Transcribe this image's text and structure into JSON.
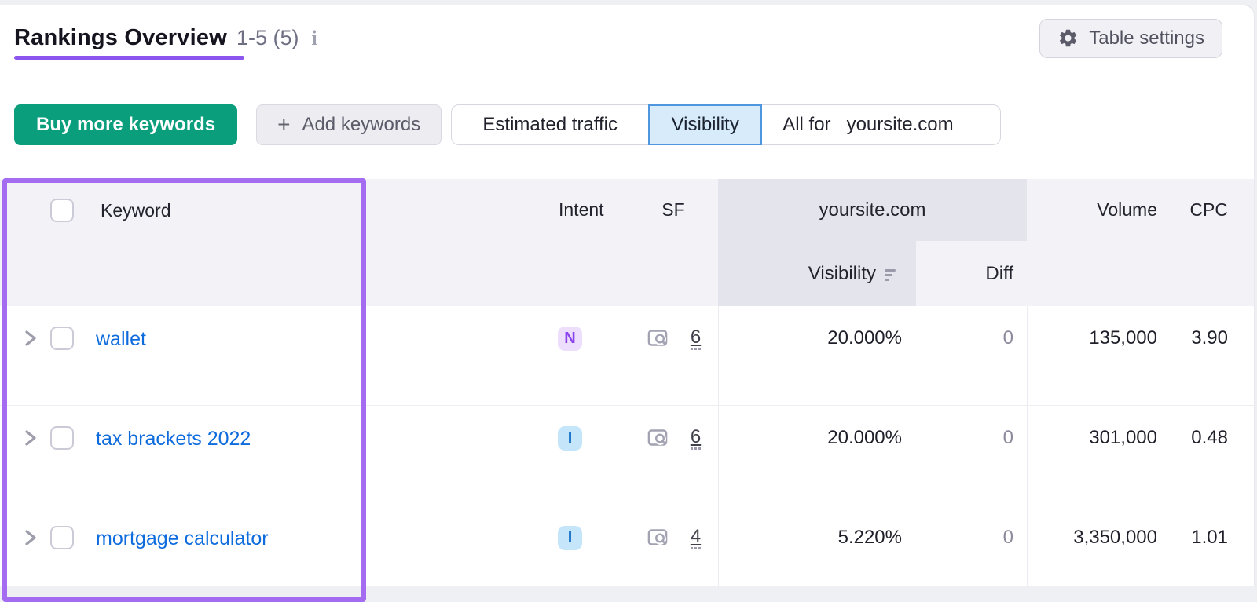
{
  "page": {
    "title": "Rankings Overview",
    "results_range": "1-5 (5)"
  },
  "icons": {
    "plus": "+",
    "info": "i"
  },
  "toolbar": {
    "table_settings": "Table settings",
    "buy_more": "Buy more keywords",
    "add_keywords": "Add keywords",
    "toggle": {
      "estimated_traffic": "Estimated traffic",
      "visibility": "Visibility",
      "selected": "Visibility",
      "all_for": "All for",
      "domain": "yoursite.com"
    }
  },
  "table": {
    "headers": {
      "keyword": "Keyword",
      "intent": "Intent",
      "sf": "SF",
      "domain_group": "yoursite.com",
      "visibility": "Visibility",
      "diff": "Diff",
      "volume": "Volume",
      "cpc": "CPC"
    },
    "rows": [
      {
        "keyword": "wallet",
        "intent": "N",
        "sf": "6",
        "visibility": "20.000%",
        "diff": "0",
        "volume": "135,000",
        "cpc": "3.90"
      },
      {
        "keyword": "tax brackets 2022",
        "intent": "I",
        "sf": "6",
        "visibility": "20.000%",
        "diff": "0",
        "volume": "301,000",
        "cpc": "0.48"
      },
      {
        "keyword": "mortgage calculator",
        "intent": "I",
        "sf": "4",
        "visibility": "5.220%",
        "diff": "0",
        "volume": "3,350,000",
        "cpc": "1.01"
      }
    ]
  },
  "colors": {
    "accent-purple": "#8d55ef",
    "annotation-purple": "#a46cf0",
    "green-button": "#0a9e7d",
    "link-blue": "#0d6bdd",
    "selected-toggle-bg": "#d7ebfb",
    "selected-toggle-border": "#4e96dd",
    "header-bg": "#f3f3f7",
    "group-header-bg": "#e4e4ec",
    "intent-n-bg": "#ecdefc",
    "intent-n-text": "#8a43ec",
    "intent-i-bg": "#c5e6fa",
    "intent-i-text": "#1a74c8"
  }
}
